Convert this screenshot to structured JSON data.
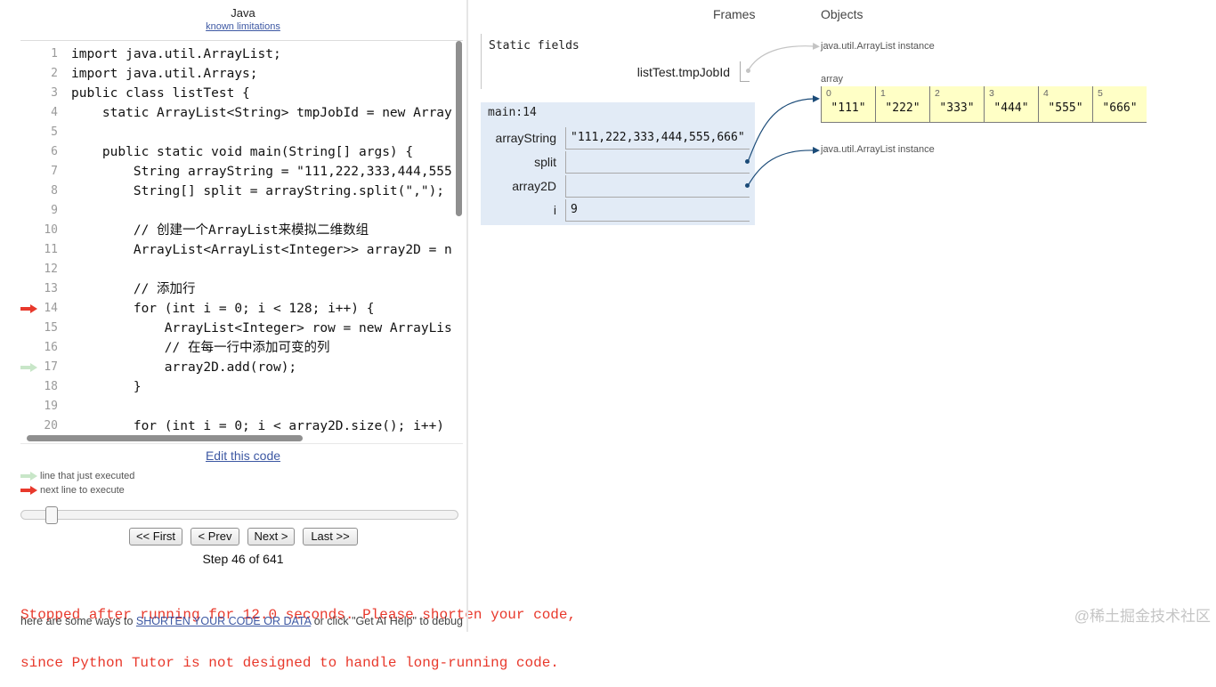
{
  "editor": {
    "language": "Java",
    "limitations_link": "known limitations",
    "next_line": 14,
    "executed_line": 17,
    "lines": [
      {
        "n": "1",
        "text": "import java.util.ArrayList;"
      },
      {
        "n": "2",
        "text": "import java.util.Arrays;"
      },
      {
        "n": "3",
        "text": "public class listTest {"
      },
      {
        "n": "4",
        "text": "    static ArrayList<String> tmpJobId = new Array"
      },
      {
        "n": "5",
        "text": ""
      },
      {
        "n": "6",
        "text": "    public static void main(String[] args) {"
      },
      {
        "n": "7",
        "text": "        String arrayString = \"111,222,333,444,555"
      },
      {
        "n": "8",
        "text": "        String[] split = arrayString.split(\",\");"
      },
      {
        "n": "9",
        "text": ""
      },
      {
        "n": "10",
        "text": "        // 创建一个ArrayList来模拟二维数组"
      },
      {
        "n": "11",
        "text": "        ArrayList<ArrayList<Integer>> array2D = n"
      },
      {
        "n": "12",
        "text": ""
      },
      {
        "n": "13",
        "text": "        // 添加行"
      },
      {
        "n": "14",
        "text": "        for (int i = 0; i < 128; i++) {"
      },
      {
        "n": "15",
        "text": "            ArrayList<Integer> row = new ArrayLis"
      },
      {
        "n": "16",
        "text": "            // 在每一行中添加可变的列"
      },
      {
        "n": "17",
        "text": "            array2D.add(row);"
      },
      {
        "n": "18",
        "text": "        }"
      },
      {
        "n": "19",
        "text": ""
      },
      {
        "n": "20",
        "text": "        for (int i = 0; i < array2D.size(); i++)"
      }
    ],
    "edit_link": "Edit this code"
  },
  "legend": {
    "executed": "line that just executed",
    "next": "next line to execute"
  },
  "navigation": {
    "current_step": 46,
    "total_steps": 641,
    "first_label": "<< First",
    "prev_label": "< Prev",
    "next_label": "Next >",
    "last_label": "Last >>",
    "step_label": "Step 46 of 641"
  },
  "error": {
    "line1": "Stopped after running for 12.0 seconds. Please shorten your code,",
    "line2": "since Python Tutor is not designed to handle long-running code."
  },
  "help": {
    "prefix": "here are some ways to ",
    "link": "SHORTEN YOUR CODE OR DATA",
    "suffix": " or click \"Get AI Help\" to debug"
  },
  "visualizer": {
    "frames_header": "Frames",
    "objects_header": "Objects",
    "static_frame": {
      "title": "Static fields",
      "vars": [
        {
          "name": "listTest.tmpJobId",
          "value": null,
          "is_pointer": true
        }
      ]
    },
    "stack_frame": {
      "title": "main:14",
      "vars": [
        {
          "name": "arrayString",
          "value": "\"111,222,333,444,555,666\"",
          "is_pointer": false
        },
        {
          "name": "split",
          "value": null,
          "is_pointer": true
        },
        {
          "name": "array2D",
          "value": null,
          "is_pointer": true
        },
        {
          "name": "i",
          "value": "9",
          "is_pointer": false
        }
      ]
    },
    "objects": {
      "tmpjobid_instance": {
        "label": "java.util.ArrayList instance"
      },
      "split_array": {
        "label": "array",
        "elements": [
          {
            "index": "0",
            "value": "\"111\""
          },
          {
            "index": "1",
            "value": "\"222\""
          },
          {
            "index": "2",
            "value": "\"333\""
          },
          {
            "index": "3",
            "value": "\"444\""
          },
          {
            "index": "4",
            "value": "\"555\""
          },
          {
            "index": "5",
            "value": "\"666\""
          }
        ]
      },
      "array2d_instance": {
        "label": "java.util.ArrayList instance"
      }
    }
  },
  "watermark": "@稀土掘金技术社区",
  "colors": {
    "next_line_arrow": "#e8392c",
    "executed_line_arrow": "#c8e6c8",
    "error_text": "#e8392c",
    "link": "#3d58a3",
    "frame_highlight": "#e2ebf6",
    "array_cell": "#ffffc6",
    "pointer": "#1b4b78",
    "inactive_pointer": "#c4c4c4"
  }
}
